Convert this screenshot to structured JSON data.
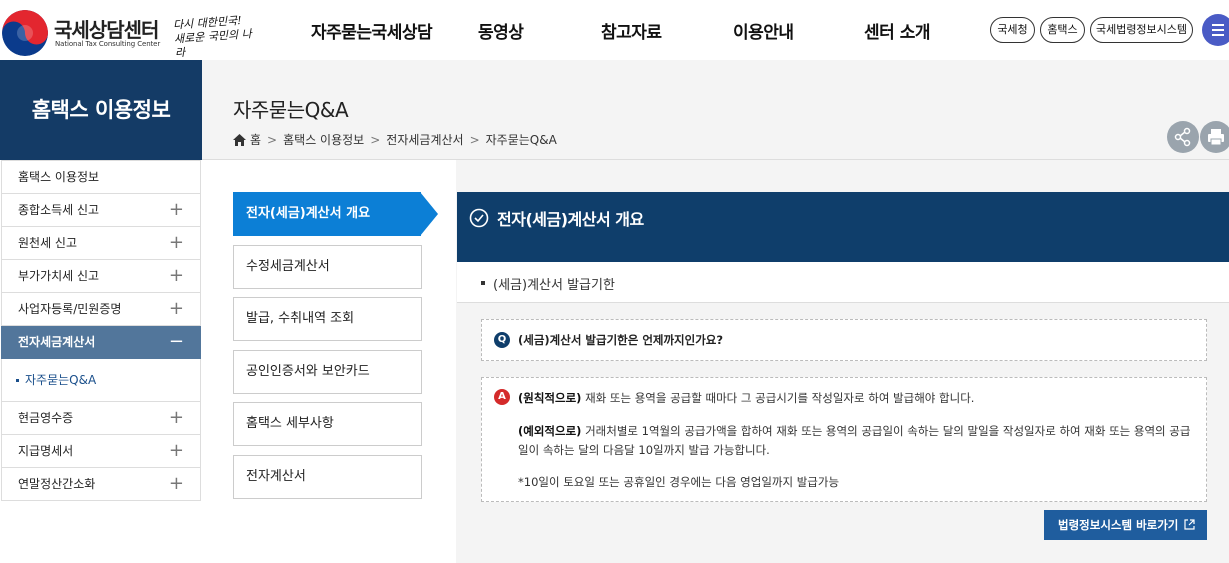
{
  "header": {
    "logo_ko": "국세상담센터",
    "logo_en": "National Tax Consulting Center",
    "slogan_line1": "다시 대한민국!",
    "slogan_line2": "새로운 국민의 나라",
    "nav": [
      "자주묻는국세상담",
      "동영상",
      "참고자료",
      "이용안내",
      "센터 소개"
    ],
    "links": [
      "국세청",
      "홈택스",
      "국세법령정보시스템"
    ]
  },
  "sidebar": {
    "title": "홈택스 이용정보",
    "items": [
      {
        "label": "홈택스 이용정보",
        "pm": ""
      },
      {
        "label": "종합소득세 신고",
        "pm": "+"
      },
      {
        "label": "원천세 신고",
        "pm": "+"
      },
      {
        "label": "부가가치세 신고",
        "pm": "+"
      },
      {
        "label": "사업자등록/민원증명",
        "pm": "+"
      },
      {
        "label": "전자세금계산서",
        "pm": "−"
      },
      {
        "label": "현금영수증",
        "pm": "+"
      },
      {
        "label": "지급명세서",
        "pm": "+"
      },
      {
        "label": "연말정산간소화",
        "pm": "+"
      }
    ],
    "sub_item": "자주묻는Q&A"
  },
  "page": {
    "title": "자주묻는Q&A",
    "breadcrumb": [
      "홈",
      "홈택스 이용정보",
      "전자세금계산서",
      "자주묻는Q&A"
    ]
  },
  "tabs": [
    "전자(세금)계산서 개요",
    "수정세금계산서",
    "발급, 수취내역 조회",
    "공인인증서와 보안카드",
    "홈택스 세부사항",
    "전자계산서"
  ],
  "panel": {
    "title": "전자(세금)계산서 개요",
    "subhead": "(세금)계산서 발급기한",
    "q_badge": "Q",
    "question": "(세금)계산서 발급기한은 언제까지인가요?",
    "a_badge": "A",
    "a1_bold": "(원칙적으로)",
    "a1_text": " 재화 또는 용역을 공급할 때마다 그 공급시기를 작성일자로 하여 발급해야 합니다.",
    "a2_bold": "(예외적으로)",
    "a2_text": " 거래처별로 1역월의 공급가액을 합하여 재화 또는 용역의 공급일이 속하는 달의 말일을 작성일자로 하여 재화 또는 용역의 공급일이 속하는 달의 다음달 10일까지 발급 가능합니다.",
    "a3_text": "*10일이 토요일 또는 공휴일인 경우에는 다음 영업일까지 발급가능",
    "link_button": "법령정보시스템 바로가기"
  },
  "colors": {
    "navy": "#0f3e6b",
    "sidebar_title": "#143b66",
    "active_tab": "#0c7fd6",
    "sidebar_active": "#52769b",
    "answer_badge": "#d42a2a",
    "menu_button": "#4a5bc5"
  }
}
